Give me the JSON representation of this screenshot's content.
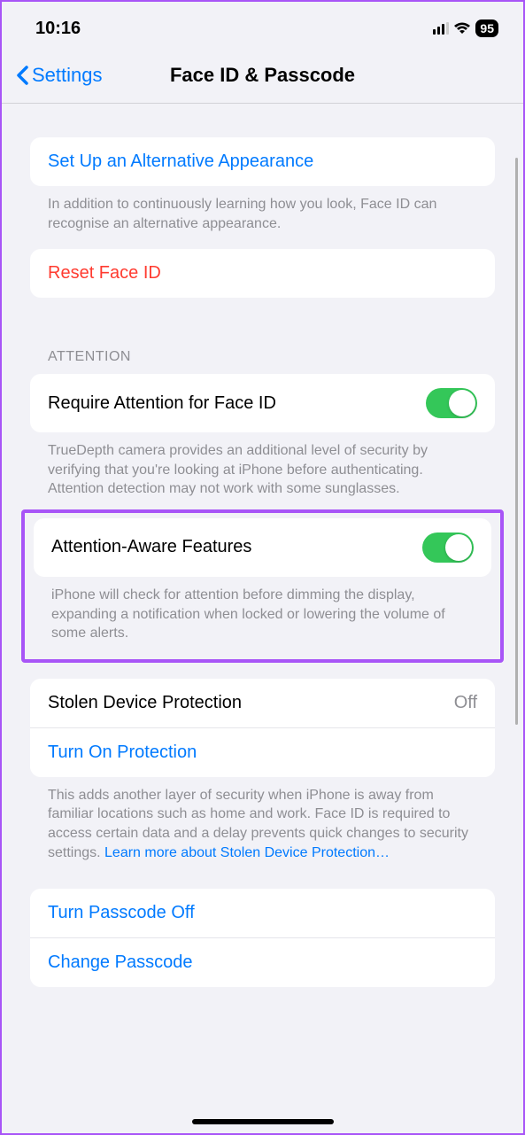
{
  "statusBar": {
    "time": "10:16",
    "battery": "95"
  },
  "nav": {
    "back": "Settings",
    "title": "Face ID & Passcode"
  },
  "setupAlt": {
    "label": "Set Up an Alternative Appearance",
    "footer": "In addition to continuously learning how you look, Face ID can recognise an alternative appearance."
  },
  "resetFaceId": {
    "label": "Reset Face ID"
  },
  "attention": {
    "header": "ATTENTION",
    "requireLabel": "Require Attention for Face ID",
    "requireFooter": "TrueDepth camera provides an additional level of security by verifying that you're looking at iPhone before authenticating. Attention detection may not work with some sunglasses.",
    "awareLabel": "Attention-Aware Features",
    "awareFooter": "iPhone will check for attention before dimming the display, expanding a notification when locked or lowering the volume of some alerts."
  },
  "stolen": {
    "label": "Stolen Device Protection",
    "value": "Off",
    "turnOn": "Turn On Protection",
    "footer1": "This adds another layer of security when iPhone is away from familiar locations such as home and work. Face ID is required to access certain data and a delay prevents quick changes to security settings. ",
    "learnMore": "Learn more about Stolen Device Protection…"
  },
  "passcode": {
    "turnOff": "Turn Passcode Off",
    "change": "Change Passcode"
  }
}
